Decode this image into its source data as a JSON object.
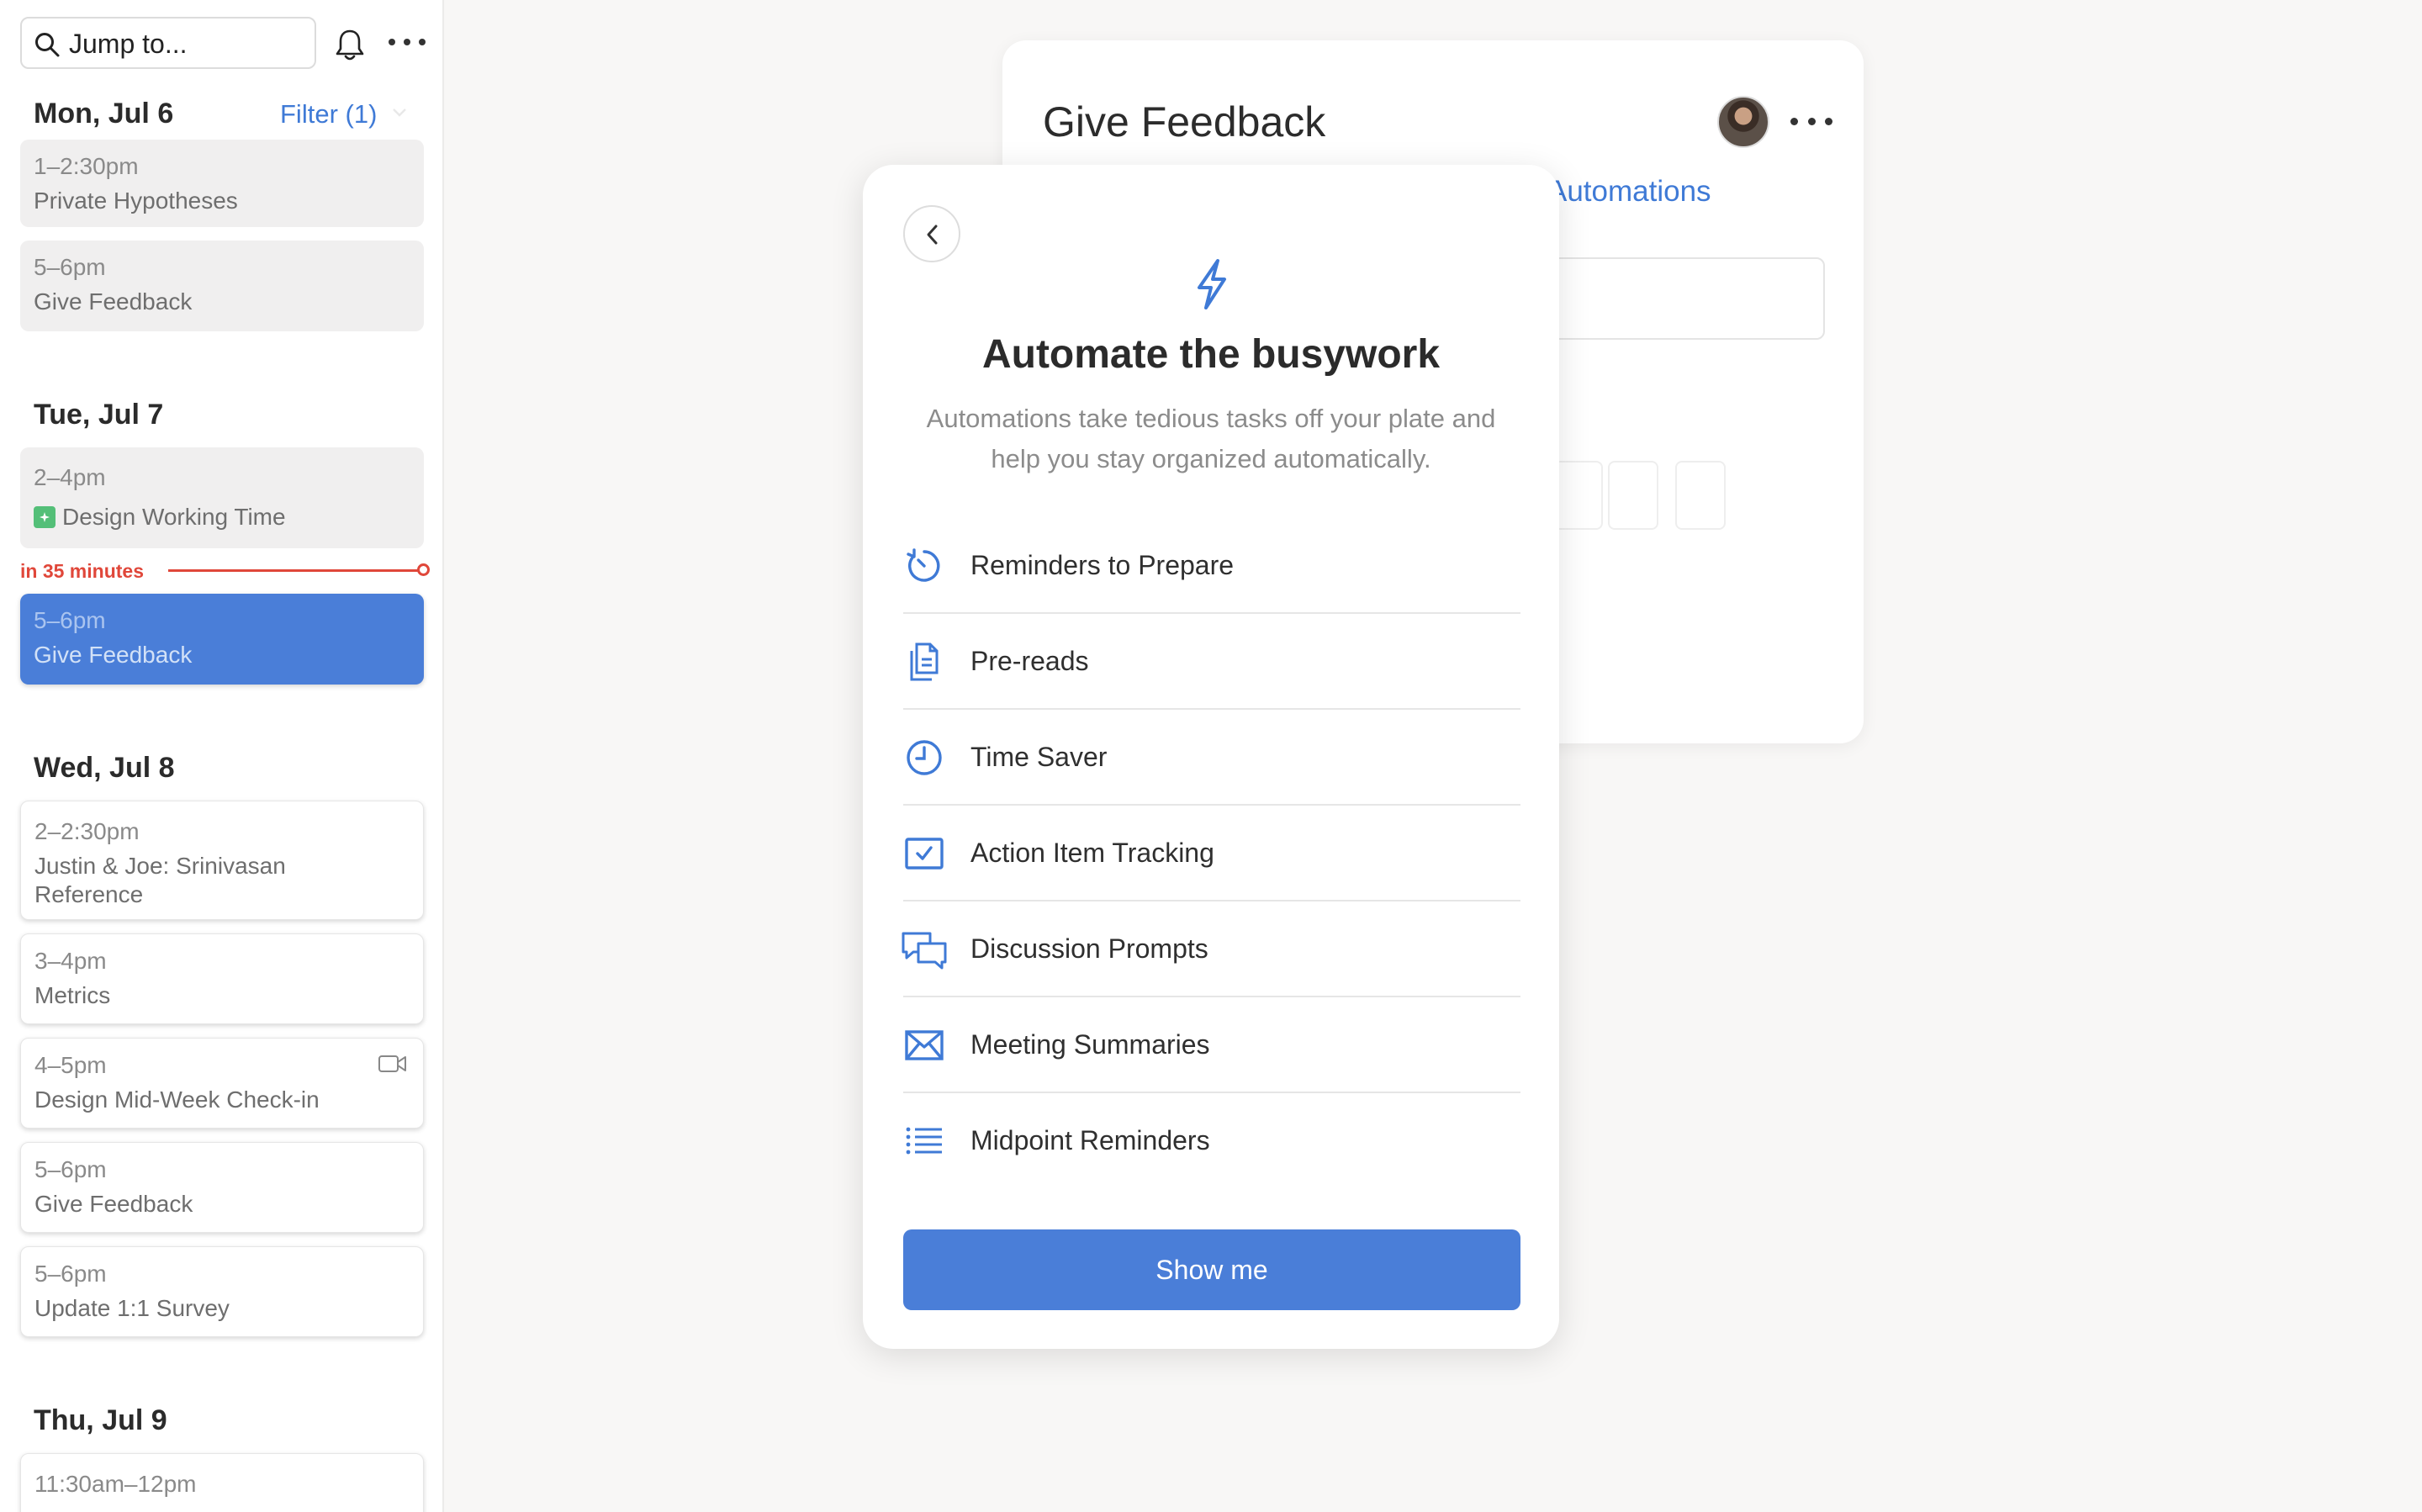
{
  "sidebar": {
    "search": {
      "placeholder": "Jump to..."
    },
    "filter_label": "Filter (1)",
    "now_indicator": "in 35 minutes",
    "days": [
      {
        "label": "Mon, Jul 6",
        "events": [
          {
            "time": "1–2:30pm",
            "title": "Private Hypotheses"
          },
          {
            "time": "5–6pm",
            "title": "Give Feedback"
          }
        ]
      },
      {
        "label": "Tue, Jul 7",
        "events": [
          {
            "time": "2–4pm",
            "title": "Design Working Time"
          },
          {
            "time": "5–6pm",
            "title": "Give Feedback"
          }
        ]
      },
      {
        "label": "Wed, Jul 8",
        "events": [
          {
            "time": "2–2:30pm",
            "title": "Justin & Joe: Srinivasan Reference"
          },
          {
            "time": "3–4pm",
            "title": "Metrics"
          },
          {
            "time": "4–5pm",
            "title": "Design Mid-Week Check-in"
          },
          {
            "time": "5–6pm",
            "title": "Give Feedback"
          },
          {
            "time": "5–6pm",
            "title": "Update 1:1 Survey"
          }
        ]
      },
      {
        "label": "Thu, Jul 9",
        "events": [
          {
            "time": "11:30am–12pm",
            "title": ""
          }
        ]
      }
    ]
  },
  "back_card": {
    "title": "Give Feedback",
    "automations_link": "Automations"
  },
  "modal": {
    "title": "Automate the busywork",
    "subtitle": "Automations take tedious tasks off your plate and help you stay organized automatically.",
    "items": [
      {
        "label": "Reminders to Prepare",
        "icon": "timer-icon"
      },
      {
        "label": "Pre-reads",
        "icon": "documents-icon"
      },
      {
        "label": "Time Saver",
        "icon": "clock-icon"
      },
      {
        "label": "Action Item Tracking",
        "icon": "checkbox-icon"
      },
      {
        "label": "Discussion Prompts",
        "icon": "chat-bubbles-icon"
      },
      {
        "label": "Meeting Summaries",
        "icon": "envelope-icon"
      },
      {
        "label": "Midpoint Reminders",
        "icon": "list-icon"
      }
    ],
    "cta": "Show me"
  },
  "colors": {
    "accent": "#4a7ed8",
    "link": "#3f7ad6",
    "now_line": "#e0473a",
    "tag_green": "#54bf78"
  }
}
